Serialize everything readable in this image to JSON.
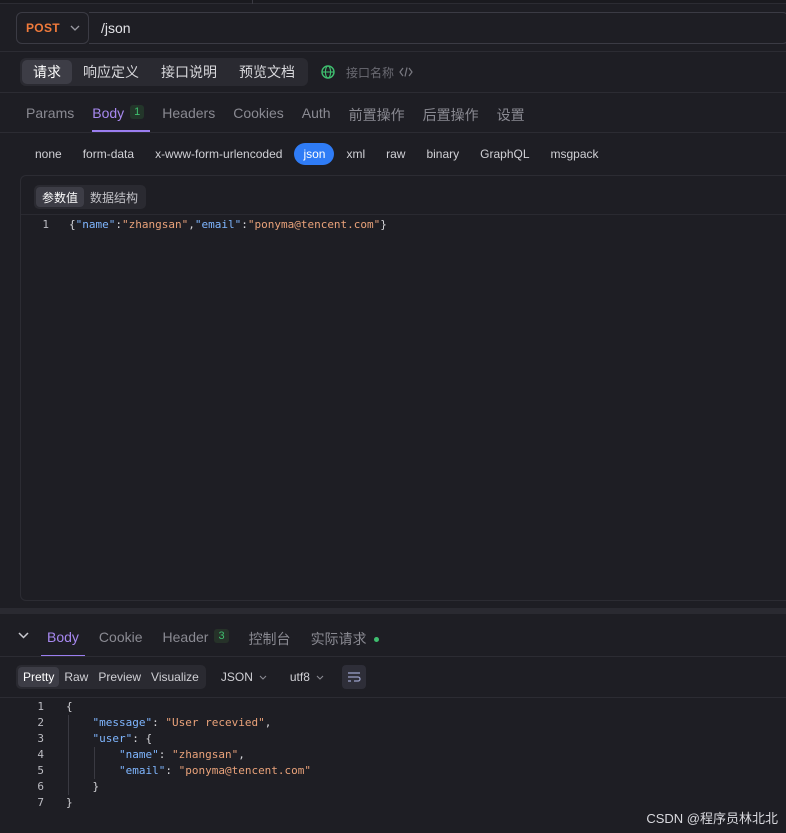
{
  "request": {
    "method": "POST",
    "url": "/json",
    "segments": [
      "请求",
      "响应定义",
      "接口说明",
      "预览文档"
    ],
    "active_segment": "请求",
    "api_name_placeholder": "接口名称",
    "tabs": [
      {
        "label": "Params"
      },
      {
        "label": "Body",
        "badge": "1"
      },
      {
        "label": "Headers"
      },
      {
        "label": "Cookies"
      },
      {
        "label": "Auth"
      },
      {
        "label": "前置操作"
      },
      {
        "label": "后置操作"
      },
      {
        "label": "设置"
      }
    ],
    "active_tab": "Body",
    "body_types": [
      "none",
      "form-data",
      "x-www-form-urlencoded",
      "json",
      "xml",
      "raw",
      "binary",
      "GraphQL",
      "msgpack"
    ],
    "active_body_type": "json",
    "editor_tabs": [
      "参数值",
      "数据结构"
    ],
    "body_line_number": "1"
  },
  "response": {
    "tabs": [
      {
        "label": "Body"
      },
      {
        "label": "Cookie"
      },
      {
        "label": "Header",
        "badge": "3"
      },
      {
        "label": "控制台"
      },
      {
        "label": "实际请求"
      }
    ],
    "active_tab": "Body",
    "view_modes": [
      "Pretty",
      "Raw",
      "Preview",
      "Visualize"
    ],
    "active_view_mode": "Pretty",
    "format": "JSON",
    "encoding": "utf8",
    "line_numbers": [
      "1",
      "2",
      "3",
      "4",
      "5",
      "6",
      "7"
    ]
  },
  "watermark": "CSDN @程序员林北北",
  "colors": {
    "accent": "#9b7ef0",
    "method": "#f07a3b",
    "json_active": "#2f7cf6",
    "success": "#3fbf6f",
    "json_key": "#7fb6ff",
    "json_string": "#e9a27a"
  }
}
